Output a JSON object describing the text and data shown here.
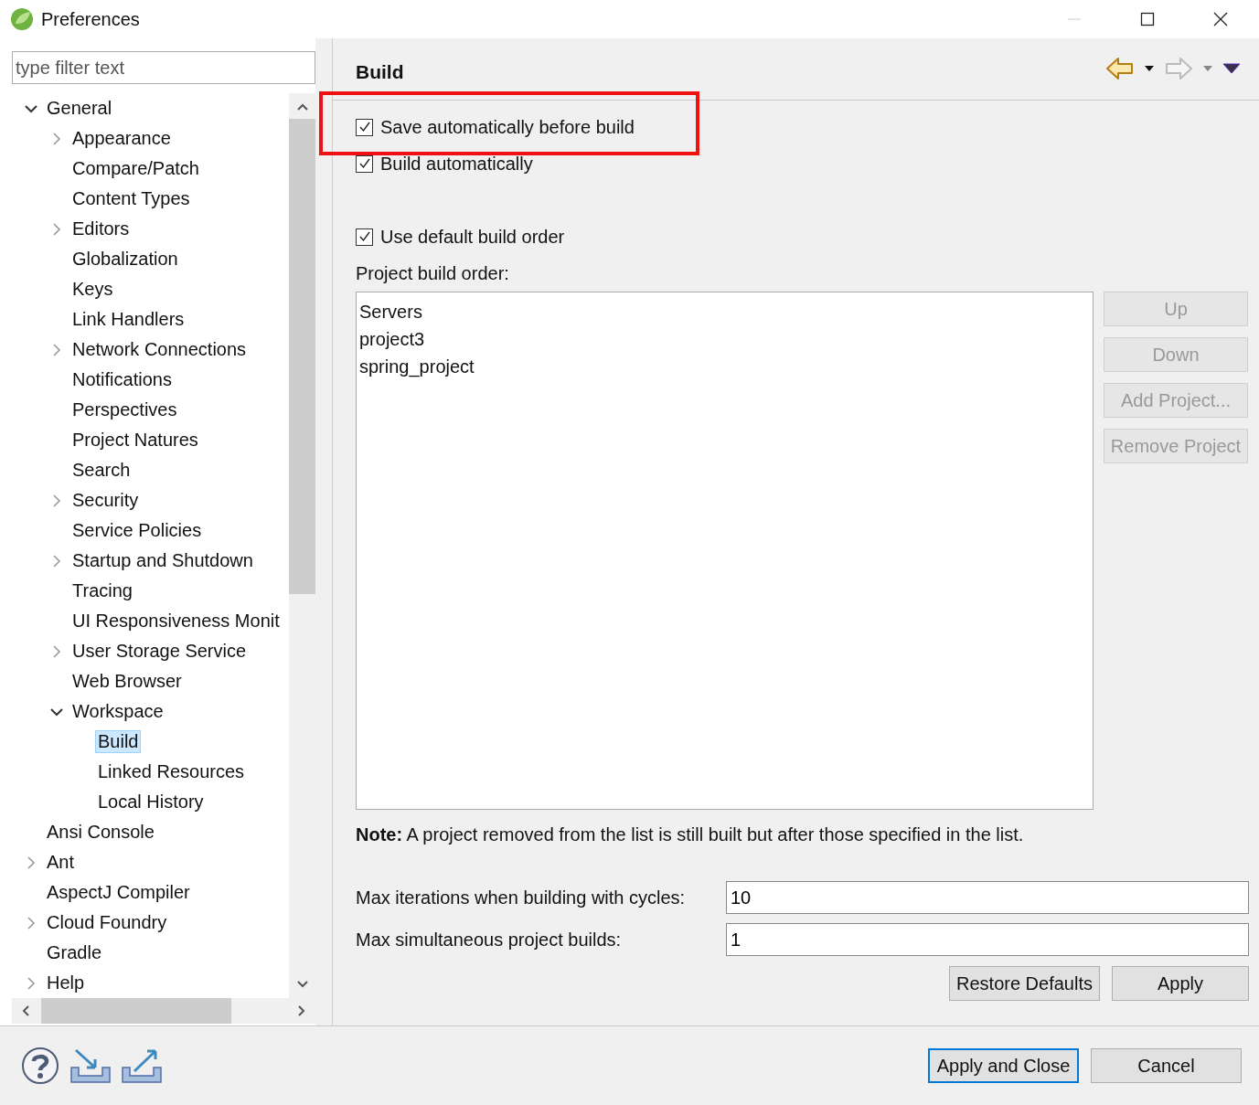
{
  "window": {
    "title": "Preferences"
  },
  "filter": {
    "placeholder": "type filter text"
  },
  "tree": [
    {
      "label": "General",
      "expanded": true,
      "selected": false,
      "children": [
        {
          "label": "Appearance",
          "expanded": false,
          "selected": false
        },
        {
          "label": "Compare/Patch",
          "selected": false
        },
        {
          "label": "Content Types",
          "selected": false
        },
        {
          "label": "Editors",
          "expanded": false,
          "selected": false
        },
        {
          "label": "Globalization",
          "selected": false
        },
        {
          "label": "Keys",
          "selected": false
        },
        {
          "label": "Link Handlers",
          "selected": false
        },
        {
          "label": "Network Connections",
          "expanded": false,
          "selected": false
        },
        {
          "label": "Notifications",
          "selected": false
        },
        {
          "label": "Perspectives",
          "selected": false
        },
        {
          "label": "Project Natures",
          "selected": false
        },
        {
          "label": "Search",
          "selected": false
        },
        {
          "label": "Security",
          "expanded": false,
          "selected": false
        },
        {
          "label": "Service Policies",
          "selected": false
        },
        {
          "label": "Startup and Shutdown",
          "expanded": false,
          "selected": false
        },
        {
          "label": "Tracing",
          "selected": false
        },
        {
          "label": "UI Responsiveness Monit",
          "selected": false
        },
        {
          "label": "User Storage Service",
          "expanded": false,
          "selected": false
        },
        {
          "label": "Web Browser",
          "selected": false
        },
        {
          "label": "Workspace",
          "expanded": true,
          "selected": false,
          "children": [
            {
              "label": "Build",
              "selected": true
            },
            {
              "label": "Linked Resources",
              "selected": false
            },
            {
              "label": "Local History",
              "selected": false
            }
          ]
        }
      ]
    },
    {
      "label": "Ansi Console",
      "selected": false
    },
    {
      "label": "Ant",
      "expanded": false,
      "selected": false
    },
    {
      "label": "AspectJ Compiler",
      "selected": false
    },
    {
      "label": "Cloud Foundry",
      "expanded": false,
      "selected": false
    },
    {
      "label": "Gradle",
      "selected": false
    },
    {
      "label": "Help",
      "expanded": false,
      "selected": false
    }
  ],
  "page": {
    "title": "Build",
    "options": [
      {
        "label": "Save automatically before build",
        "checked": true,
        "highlighted": true
      },
      {
        "label": "Build automatically",
        "checked": true,
        "highlighted": false
      }
    ],
    "default_order": {
      "label": "Use default build order",
      "checked": true
    },
    "order_label": "Project build order:",
    "projects": [
      "Servers",
      "project3",
      "spring_project"
    ],
    "order_buttons": [
      {
        "label": "Up",
        "disabled": true
      },
      {
        "label": "Down",
        "disabled": true
      },
      {
        "label": "Add Project...",
        "disabled": true
      },
      {
        "label": "Remove Project",
        "disabled": true
      }
    ],
    "note": "**Note:**  A project removed from the list is still built but after those specified in the list.",
    "fields": [
      {
        "label": "Max iterations when building with cycles:",
        "value": "10"
      },
      {
        "label": "Max simultaneous project builds:",
        "value": "1"
      }
    ],
    "buttons": [
      "Restore Defaults",
      "Apply"
    ]
  },
  "footer_buttons": [
    {
      "label": "Apply and Close",
      "default": true
    },
    {
      "label": "Cancel",
      "default": false
    }
  ]
}
